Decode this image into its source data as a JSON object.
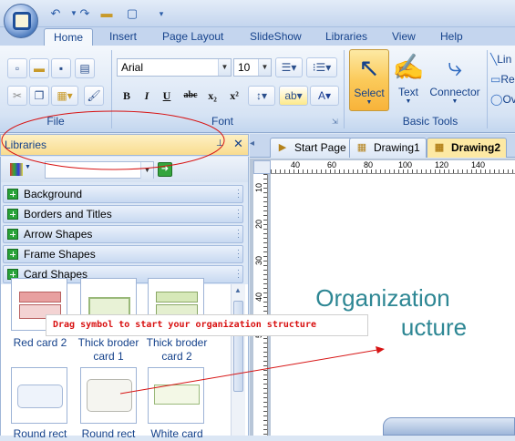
{
  "ribbon_tabs": [
    "Home",
    "Insert",
    "Page Layout",
    "SlideShow",
    "Libraries",
    "View",
    "Help"
  ],
  "active_tab": "Home",
  "font": {
    "name": "Arial",
    "size": "10"
  },
  "format_buttons": [
    "B",
    "I",
    "U",
    "abc",
    "x₂",
    "x²"
  ],
  "groups": {
    "file": "File",
    "font": "Font",
    "basic_tools": "Basic Tools"
  },
  "tools": [
    {
      "label": "Select",
      "icon": "pointer-icon"
    },
    {
      "label": "Text",
      "icon": "text-pen-icon"
    },
    {
      "label": "Connector",
      "icon": "connector-icon"
    }
  ],
  "side_tools": [
    "Lin",
    "Re",
    "Ov"
  ],
  "libraries": {
    "title": "Libraries",
    "categories": [
      "Background",
      "Borders and Titles",
      "Arrow Shapes",
      "Frame Shapes",
      "Card Shapes"
    ],
    "shapes_row1": [
      "Red card 2",
      "Thick broder card 1",
      "Thick broder card 2"
    ],
    "shapes_row2": [
      "Round rect",
      "Round rect",
      "White card"
    ]
  },
  "doc_tabs": [
    {
      "label": "Start Page",
      "active": false
    },
    {
      "label": "Drawing1",
      "active": false
    },
    {
      "label": "Drawing2",
      "active": true
    }
  ],
  "ruler": {
    "h_marks": [
      "40",
      "60",
      "80",
      "100",
      "120",
      "140"
    ],
    "v_marks": [
      "10",
      "20",
      "30",
      "40",
      "50"
    ]
  },
  "canvas": {
    "title_line1": "Organization",
    "title_line2": "ucture"
  },
  "annotation": "Drag symbol to start your organization structure"
}
